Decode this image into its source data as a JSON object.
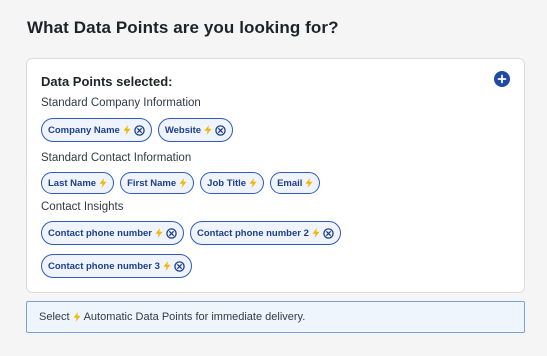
{
  "heading": "What Data Points are you looking for?",
  "card": {
    "title": "Data Points selected:",
    "sections": [
      {
        "label": "Standard Company Information",
        "chips": [
          {
            "label": "Company Name",
            "removable": true
          },
          {
            "label": "Website",
            "removable": true
          }
        ]
      },
      {
        "label": "Standard Contact Information",
        "chips": [
          {
            "label": "Last Name",
            "removable": false
          },
          {
            "label": "First Name",
            "removable": false
          },
          {
            "label": "Job Title",
            "removable": false
          },
          {
            "label": "Email",
            "removable": false
          }
        ]
      },
      {
        "label": "Contact Insights",
        "chips": [
          {
            "label": "Contact phone number",
            "removable": true
          },
          {
            "label": "Contact phone number 2",
            "removable": true
          },
          {
            "label": "Contact phone number 3",
            "removable": true
          }
        ]
      }
    ]
  },
  "notice": {
    "prefix": "Select",
    "suffix": "Automatic Data Points for immediate delivery."
  },
  "colors": {
    "accent": "#1e4aa6",
    "chip_border": "#2f5bb7",
    "bolt": "#f2b705"
  },
  "icons": {
    "add": "plus-circle-icon",
    "remove": "close-circle-icon",
    "automatic": "lightning-bolt-icon"
  }
}
